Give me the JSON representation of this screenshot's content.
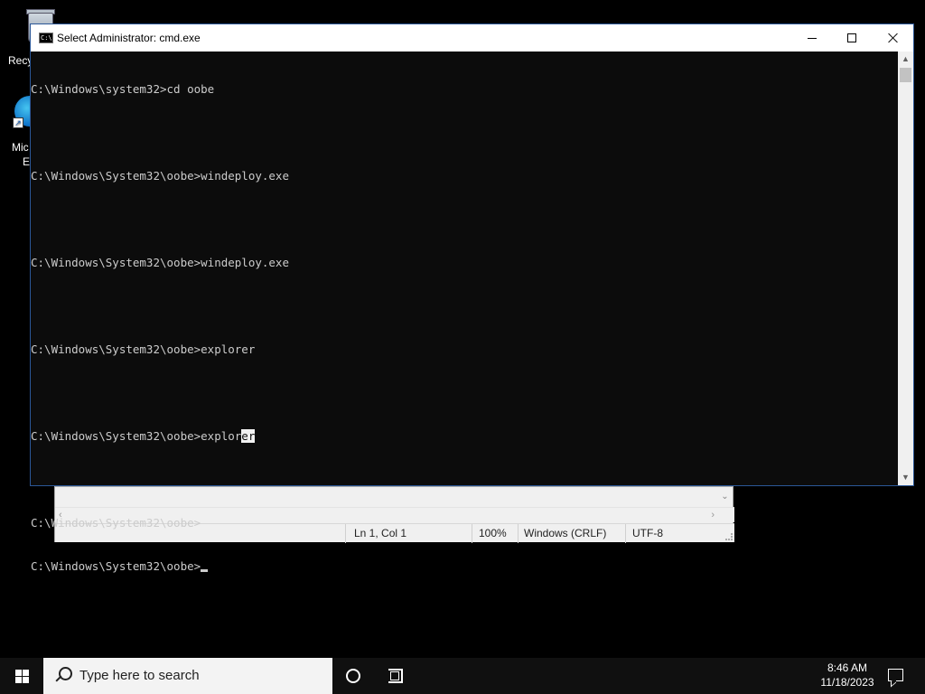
{
  "desktop": {
    "recycle_label": "Recy",
    "edge_label_line1": "Mic",
    "edge_label_line2": "E"
  },
  "cmd_window": {
    "title": "Select Administrator: cmd.exe",
    "icon_text": "C:\\",
    "lines": [
      "C:\\Windows\\system32>cd oobe",
      "",
      "C:\\Windows\\System32\\oobe>windeploy.exe",
      "",
      "C:\\Windows\\System32\\oobe>windeploy.exe",
      "",
      "C:\\Windows\\System32\\oobe>explorer",
      ""
    ],
    "line_selected_prefix": "C:\\Windows\\System32\\oobe>explor",
    "line_selected_text": "er",
    "lines_after": [
      "",
      "C:\\Windows\\System32\\oobe>"
    ],
    "prompt_line": "C:\\Windows\\System32\\oobe>"
  },
  "notepad_status": {
    "position": "Ln 1, Col 1",
    "zoom": "100%",
    "line_ending": "Windows (CRLF)",
    "encoding": "UTF-8"
  },
  "taskbar": {
    "search_placeholder": "Type here to search",
    "time": "8:46 AM",
    "date": "11/18/2023"
  }
}
